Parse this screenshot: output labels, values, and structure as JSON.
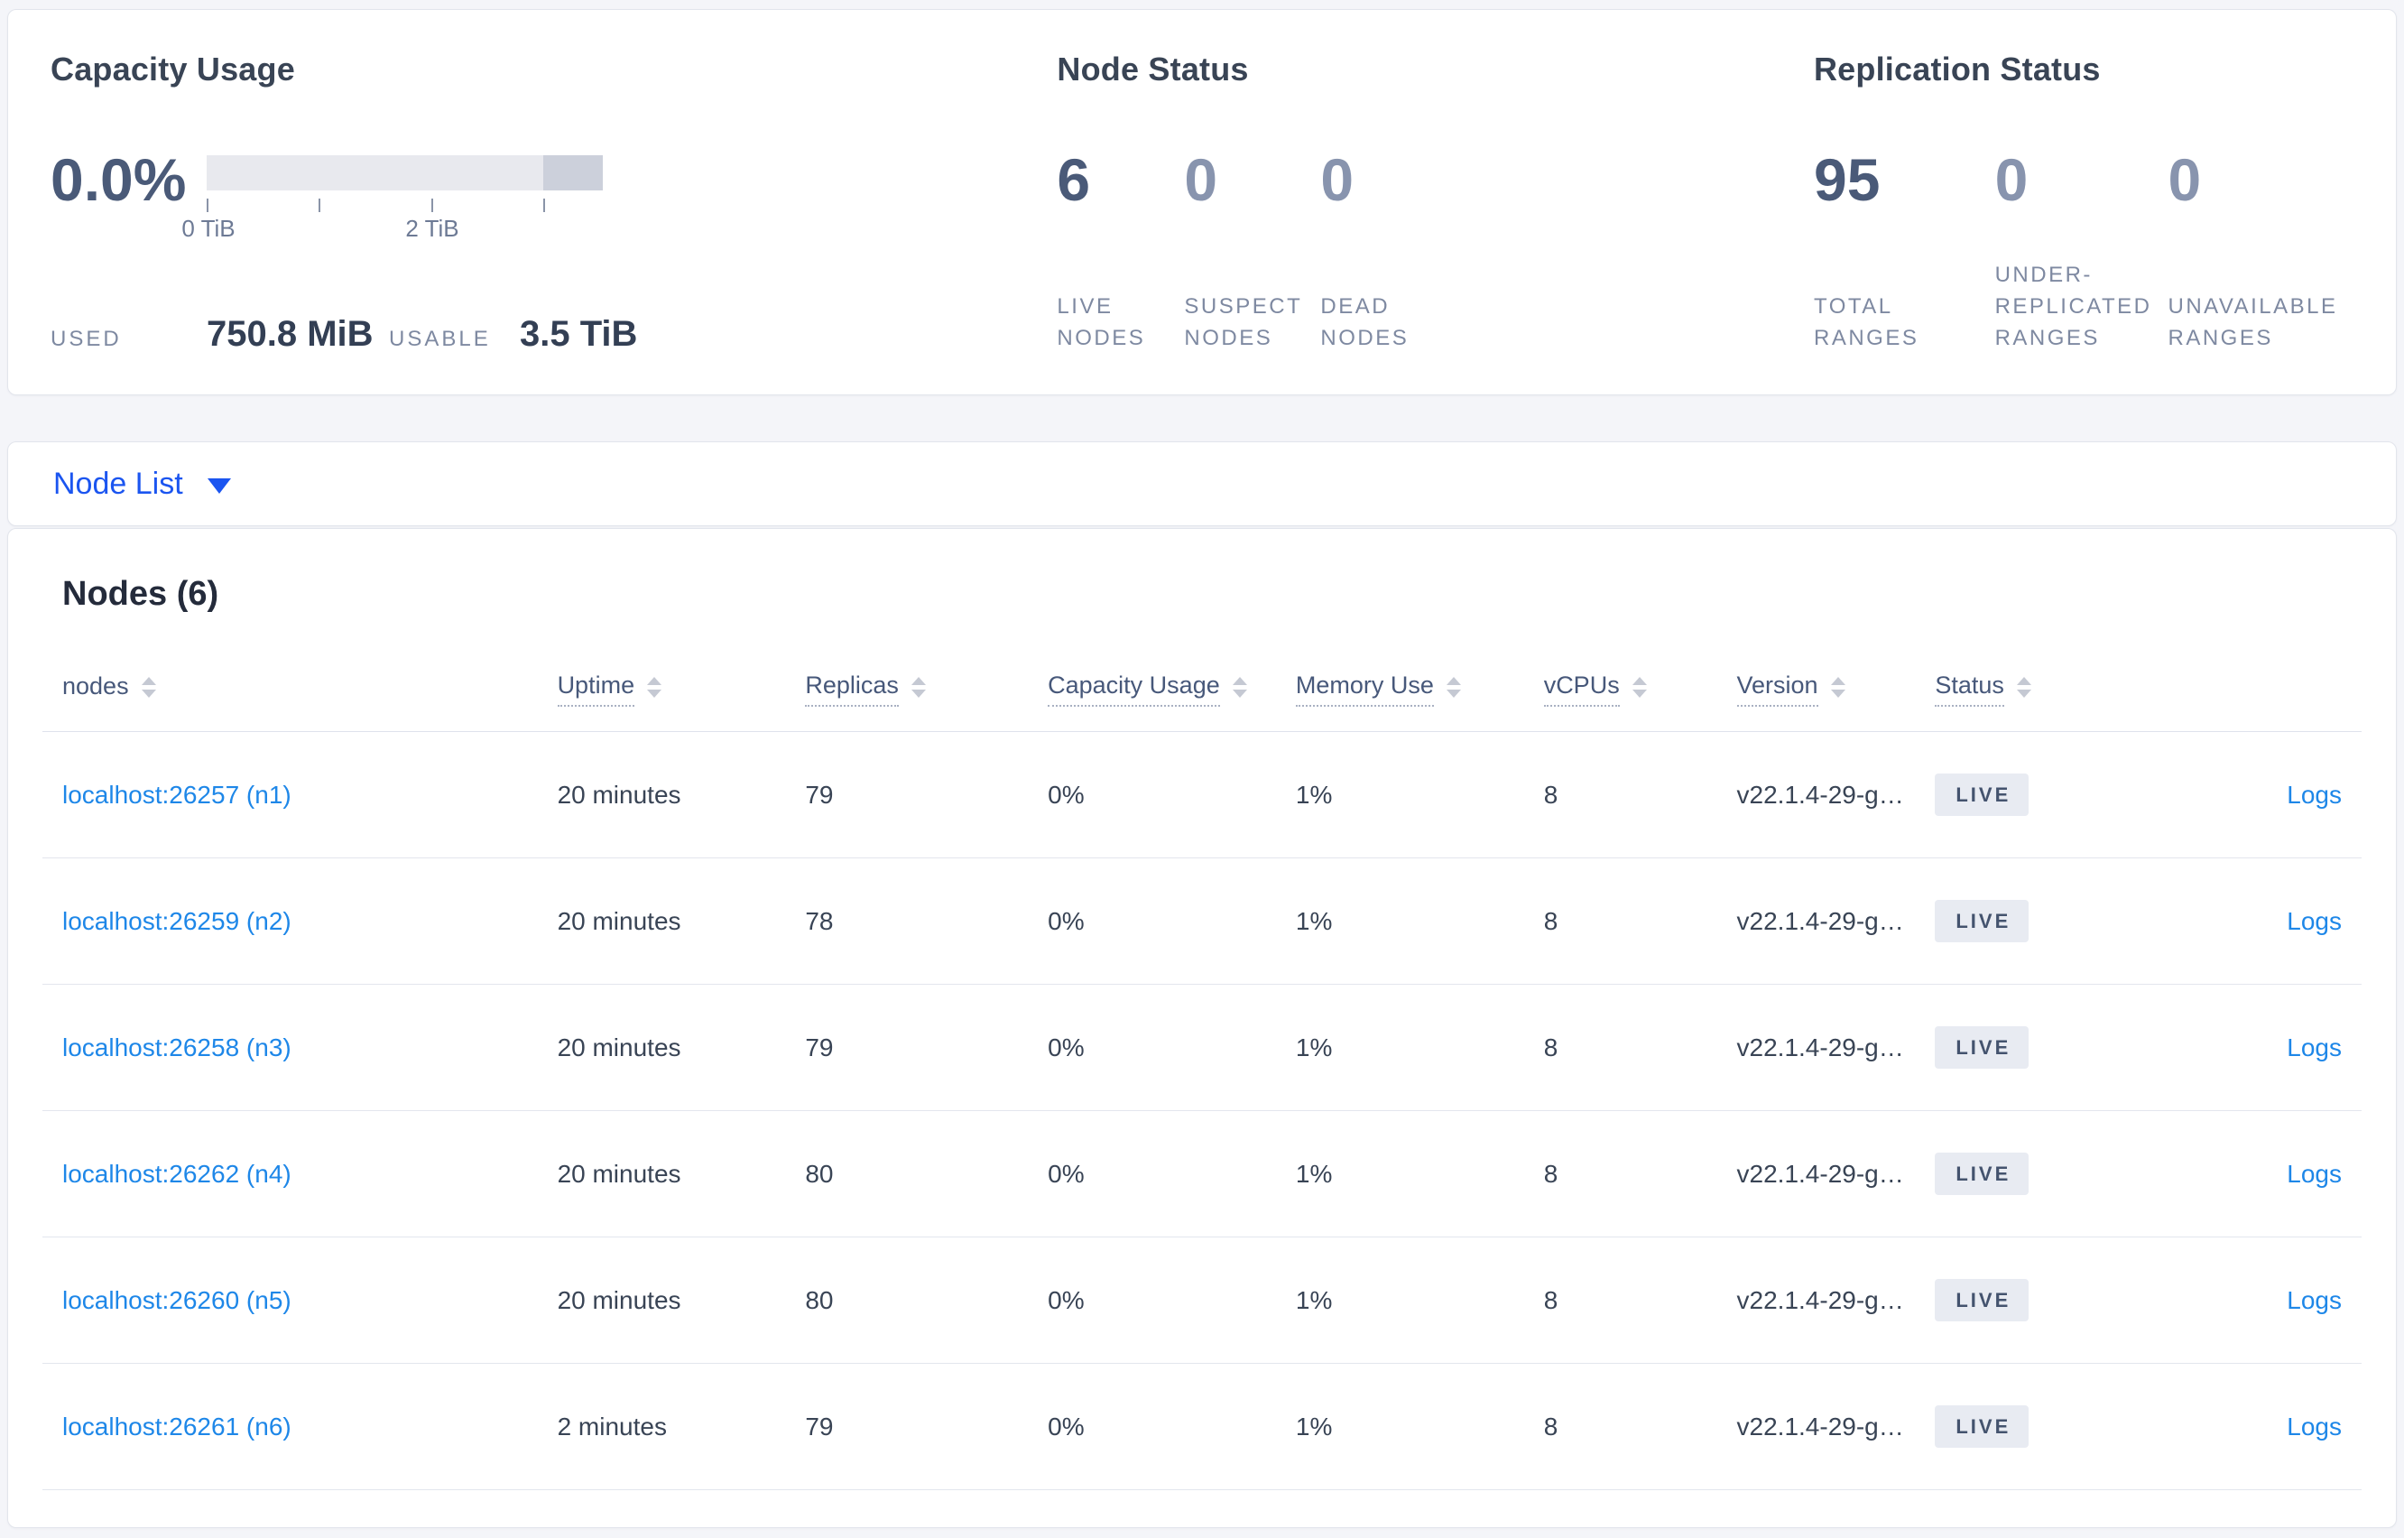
{
  "overview": {
    "capacity": {
      "title": "Capacity Usage",
      "percent": "0.0%",
      "axis": {
        "start_label": "0 TiB",
        "mid_label": "2 TiB"
      },
      "used_label": "USED",
      "used_value": "750.8 MiB",
      "usable_label": "USABLE",
      "usable_value": "3.5 TiB",
      "bar": {
        "track_color": "#e8e9ee",
        "reserved_color": "#ccd0db",
        "used_fraction": 0.0,
        "axis_max_tib": 3.5
      }
    },
    "node_status": {
      "title": "Node Status",
      "stats": [
        {
          "value": "6",
          "label": "LIVE NODES"
        },
        {
          "value": "0",
          "label": "SUSPECT NODES"
        },
        {
          "value": "0",
          "label": "DEAD NODES"
        }
      ]
    },
    "replication": {
      "title": "Replication Status",
      "stats": [
        {
          "value": "95",
          "label": "TOTAL RANGES"
        },
        {
          "value": "0",
          "label": "UNDER-REPLICATED RANGES"
        },
        {
          "value": "0",
          "label": "UNAVAILABLE RANGES"
        }
      ]
    }
  },
  "node_list_button": {
    "label": "Node List"
  },
  "table": {
    "heading": "Nodes (6)",
    "columns": [
      {
        "label": "nodes"
      },
      {
        "label": "Uptime"
      },
      {
        "label": "Replicas"
      },
      {
        "label": "Capacity Usage"
      },
      {
        "label": "Memory Use"
      },
      {
        "label": "vCPUs"
      },
      {
        "label": "Version"
      },
      {
        "label": "Status"
      }
    ],
    "rows": [
      {
        "node": "localhost:26257 (n1)",
        "uptime": "20 minutes",
        "replicas": "79",
        "capacity": "0%",
        "memory": "1%",
        "vcpus": "8",
        "version": "v22.1.4-29-g…",
        "status": "LIVE",
        "logs": "Logs"
      },
      {
        "node": "localhost:26259 (n2)",
        "uptime": "20 minutes",
        "replicas": "78",
        "capacity": "0%",
        "memory": "1%",
        "vcpus": "8",
        "version": "v22.1.4-29-g…",
        "status": "LIVE",
        "logs": "Logs"
      },
      {
        "node": "localhost:26258 (n3)",
        "uptime": "20 minutes",
        "replicas": "79",
        "capacity": "0%",
        "memory": "1%",
        "vcpus": "8",
        "version": "v22.1.4-29-g…",
        "status": "LIVE",
        "logs": "Logs"
      },
      {
        "node": "localhost:26262 (n4)",
        "uptime": "20 minutes",
        "replicas": "80",
        "capacity": "0%",
        "memory": "1%",
        "vcpus": "8",
        "version": "v22.1.4-29-g…",
        "status": "LIVE",
        "logs": "Logs"
      },
      {
        "node": "localhost:26260 (n5)",
        "uptime": "20 minutes",
        "replicas": "80",
        "capacity": "0%",
        "memory": "1%",
        "vcpus": "8",
        "version": "v22.1.4-29-g…",
        "status": "LIVE",
        "logs": "Logs"
      },
      {
        "node": "localhost:26261 (n6)",
        "uptime": "2 minutes",
        "replicas": "79",
        "capacity": "0%",
        "memory": "1%",
        "vcpus": "8",
        "version": "v22.1.4-29-g…",
        "status": "LIVE",
        "logs": "Logs"
      }
    ]
  },
  "colors": {
    "page_bg": "#f4f5f9",
    "link_blue": "#1e87e8",
    "primary_blue": "#1b55f0",
    "badge_bg": "#e8ebf2",
    "badge_text": "#44536e",
    "stat_emphasis": "#4a5a78",
    "stat_muted": "#8894ae"
  }
}
